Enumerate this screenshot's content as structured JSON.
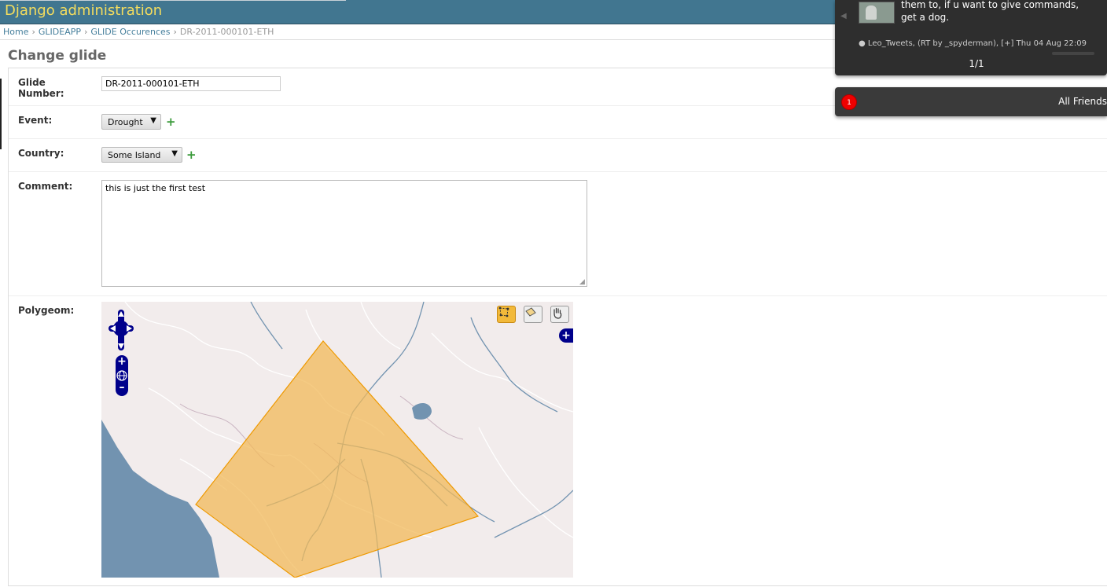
{
  "header": {
    "title": "Django administration"
  },
  "breadcrumbs": [
    {
      "label": "Home"
    },
    {
      "label": "GLIDEAPP"
    },
    {
      "label": "GLIDE Occurences"
    },
    {
      "label": "DR-2011-000101-ETH"
    }
  ],
  "page": {
    "title": "Change glide"
  },
  "form": {
    "glide_number": {
      "label_line1": "Glide",
      "label_line2": "Number:",
      "value": "DR-2011-000101-ETH"
    },
    "event": {
      "label": "Event:",
      "selected": "Drought"
    },
    "country": {
      "label": "Country:",
      "selected": "Some Island"
    },
    "comment": {
      "label": "Comment:",
      "value": "this is just the first test"
    },
    "polygeom": {
      "label": "Polygeom:"
    }
  },
  "icons": {
    "add": "+",
    "select_arrow": "▼",
    "resize": "◢",
    "prev": "◀",
    "meta_dot": "●"
  },
  "notification": {
    "message": "them to, if u want to give commands, get a dog.",
    "meta": "Leo_Tweets, (RT by _spyderman), [+] Thu 04 Aug 22:09",
    "pager": "1/1"
  },
  "friends": {
    "badge_count": "1",
    "label": "All Friends"
  },
  "colors": {
    "header_bg": "#417690",
    "header_title": "#f5dd5d",
    "link": "#447e9b",
    "polygon_fill": "#f2b95a",
    "water": "#7293b0"
  }
}
